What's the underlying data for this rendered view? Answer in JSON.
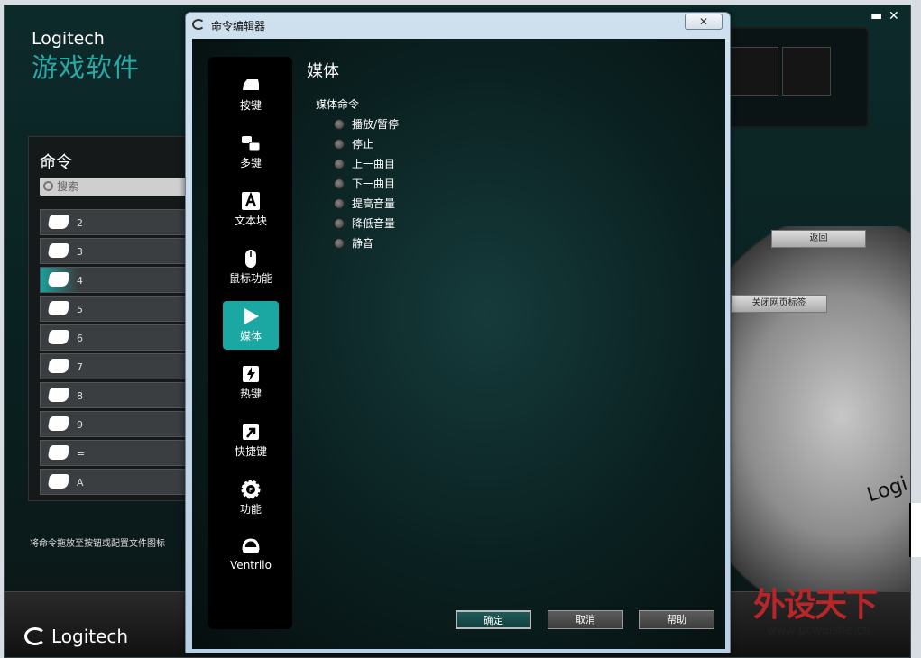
{
  "app": {
    "brand_line1": "Logitech",
    "brand_line2": "游戏软件",
    "minimize_label": "▬",
    "close_label": "✕",
    "commands_panel": {
      "title": "命令",
      "search_placeholder": "搜索",
      "items": [
        {
          "label": "2"
        },
        {
          "label": "3"
        },
        {
          "label": "4"
        },
        {
          "label": "5"
        },
        {
          "label": "6"
        },
        {
          "label": "7"
        },
        {
          "label": "8"
        },
        {
          "label": "9"
        },
        {
          "label": "="
        },
        {
          "label": "A"
        }
      ],
      "active_index": 2
    },
    "drag_hint": "将命令拖放至按钮或配置文件图标",
    "bg_buttons": {
      "back": "返回",
      "close_tab": "关闭网页标签"
    },
    "bottom_logo": "Logitech",
    "mouse_logo": "Logi",
    "watermark": "外设天下",
    "watermark_url": "www.pcwaishe.cn"
  },
  "dialog": {
    "title": "命令编辑器",
    "close_label": "✕",
    "nav": [
      {
        "label": "按键",
        "icon": "key-icon"
      },
      {
        "label": "多键",
        "icon": "multikey-icon"
      },
      {
        "label": "文本块",
        "icon": "text-block-icon"
      },
      {
        "label": "鼠标功能",
        "icon": "mouse-icon"
      },
      {
        "label": "媒体",
        "icon": "play-icon"
      },
      {
        "label": "热键",
        "icon": "hotkey-icon"
      },
      {
        "label": "快捷键",
        "icon": "shortcut-icon"
      },
      {
        "label": "功能",
        "icon": "function-gear-icon"
      },
      {
        "label": "Ventrilo",
        "icon": "headset-icon"
      }
    ],
    "active_nav": "媒体",
    "section_title": "媒体",
    "media_commands_label": "媒体命令",
    "media_options": [
      {
        "label": "播放/暂停"
      },
      {
        "label": "停止"
      },
      {
        "label": "上一曲目"
      },
      {
        "label": "下一曲目"
      },
      {
        "label": "提高音量"
      },
      {
        "label": "降低音量"
      },
      {
        "label": "静音"
      }
    ],
    "buttons": {
      "ok": "确定",
      "cancel": "取消",
      "help": "帮助"
    }
  }
}
